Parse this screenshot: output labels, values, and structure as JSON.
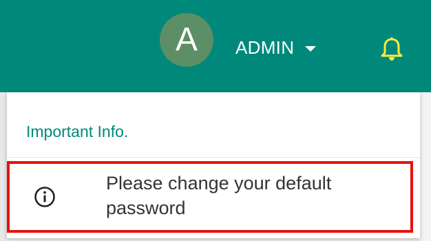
{
  "header": {
    "avatar_letter": "A",
    "user_name": "ADMIN",
    "colors": {
      "bar": "#00897b",
      "avatar": "#5c8f65",
      "bell": "#ffeb3b"
    },
    "icons": {
      "user_menu": "caret-down-icon",
      "notifications": "bell-icon"
    }
  },
  "notifications": {
    "heading": "Important Info.",
    "items": [
      {
        "icon": "info-icon",
        "text": "Please change your default password"
      }
    ],
    "highlight_color": "#e8110f"
  }
}
